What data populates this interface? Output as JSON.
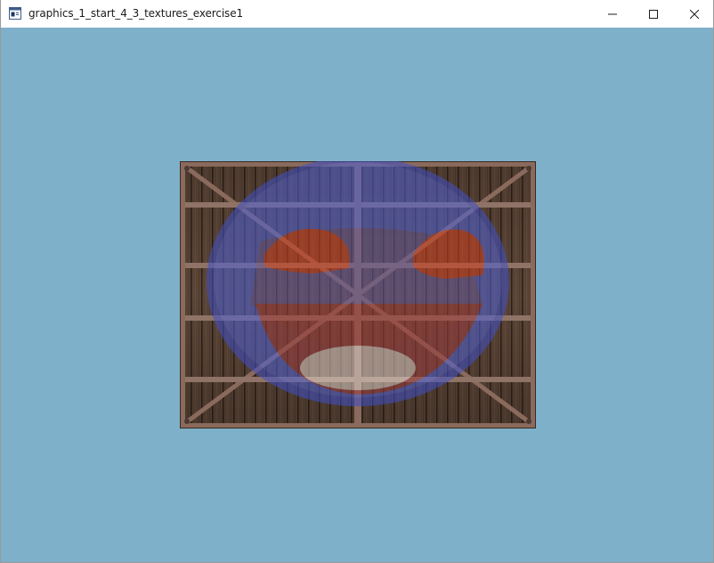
{
  "window": {
    "title": "graphics_1_start_4_3_textures_exercise1",
    "controls": [
      "minimize",
      "maximize",
      "close"
    ],
    "icons": {
      "app": "console-window-icon",
      "minimize": "minimize-icon",
      "maximize": "maximize-icon",
      "close": "close-icon"
    }
  },
  "scene": {
    "clear_color": "#7fb0c9",
    "quad": {
      "textures": [
        "wooden-container",
        "awesomeface"
      ],
      "description": "textured rectangle mixing crate texture with smiley face"
    }
  }
}
